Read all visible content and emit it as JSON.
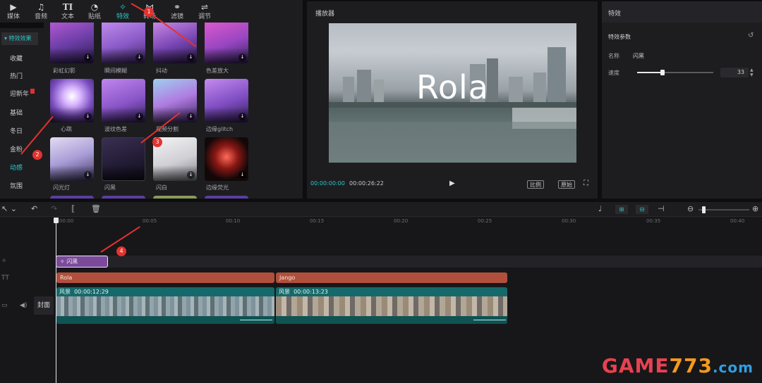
{
  "toolbar": {
    "tools": [
      {
        "label": "媒体",
        "icon": "media-icon"
      },
      {
        "label": "音频",
        "icon": "audio-icon"
      },
      {
        "label": "文本",
        "icon": "text-icon"
      },
      {
        "label": "贴纸",
        "icon": "sticker-icon"
      },
      {
        "label": "特效",
        "icon": "effects-icon"
      },
      {
        "label": "转场",
        "icon": "transition-icon"
      },
      {
        "label": "滤镜",
        "icon": "filter-icon"
      },
      {
        "label": "调节",
        "icon": "adjust-icon"
      }
    ],
    "active": "特效"
  },
  "categories": {
    "header": "▾ 特效效果",
    "items": [
      "收藏",
      "热门",
      "迎新年",
      "基础",
      "冬日",
      "金粉",
      "动感",
      "氛围"
    ],
    "selected": "动感"
  },
  "effects": [
    {
      "label": "彩虹幻影"
    },
    {
      "label": "瞬间模糊"
    },
    {
      "label": "抖动"
    },
    {
      "label": "色差放大"
    },
    {
      "label": "心跳"
    },
    {
      "label": "波纹色差"
    },
    {
      "label": "视频分割"
    },
    {
      "label": "边缘glitch"
    },
    {
      "label": "闪光灯"
    },
    {
      "label": "闪黑"
    },
    {
      "label": "闪白"
    },
    {
      "label": "边缘荧光"
    }
  ],
  "player": {
    "title": "播放器",
    "overlay_text": "Rola",
    "current_time": "00:00:00:00",
    "total_time": "00:00:26:22",
    "btn_ratio": "比例",
    "btn_original": "原始"
  },
  "properties": {
    "title": "特效",
    "section": "特效参数",
    "name_label": "名称",
    "name_value": "闪黑",
    "speed_label": "速度",
    "speed_value": "33",
    "speed_level": 0.33
  },
  "timeline": {
    "ruler": [
      "00:00",
      "00:05",
      "00:10",
      "00:15",
      "00:20",
      "00:25",
      "00:30",
      "00:35",
      "00:40"
    ],
    "effect_clip_label": "闪黑",
    "text_clips": [
      "Rola",
      "Jango"
    ],
    "video_clips": [
      {
        "label": "风景",
        "duration": "00:00:12:29"
      },
      {
        "label": "风景",
        "duration": "00:00:13:23"
      }
    ],
    "cover_label": "封面"
  },
  "annotations": [
    "1",
    "2",
    "3",
    "4"
  ],
  "watermark": "GAME773.com",
  "colors": {
    "accent": "#2fc6c4",
    "effect_clip": "#7b4a9a",
    "text_clip": "#b0503c",
    "video_clip": "#16696a",
    "marker": "#e4322e"
  }
}
